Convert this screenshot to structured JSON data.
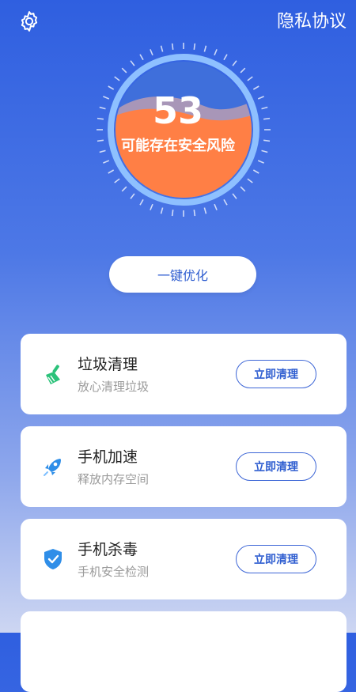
{
  "header": {
    "privacy_label": "隐私协议"
  },
  "status": {
    "score": "53",
    "risk_text": "可能存在安全风险",
    "risk_level": 0.53
  },
  "optimize_label": "一键优化",
  "cards": [
    {
      "title": "垃圾清理",
      "subtitle": "放心清理垃圾",
      "button": "立即清理",
      "icon": "broom-icon",
      "color": "#2bc27a"
    },
    {
      "title": "手机加速",
      "subtitle": "释放内存空间",
      "button": "立即清理",
      "icon": "rocket-icon",
      "color": "#2f8ee8"
    },
    {
      "title": "手机杀毒",
      "subtitle": "手机安全检测",
      "button": "立即清理",
      "icon": "shield-icon",
      "color": "#2f8ee8"
    }
  ],
  "colors": {
    "accent": "#2f5ed0",
    "risk": "#ff7f45",
    "ring": "#7fb3ff"
  }
}
